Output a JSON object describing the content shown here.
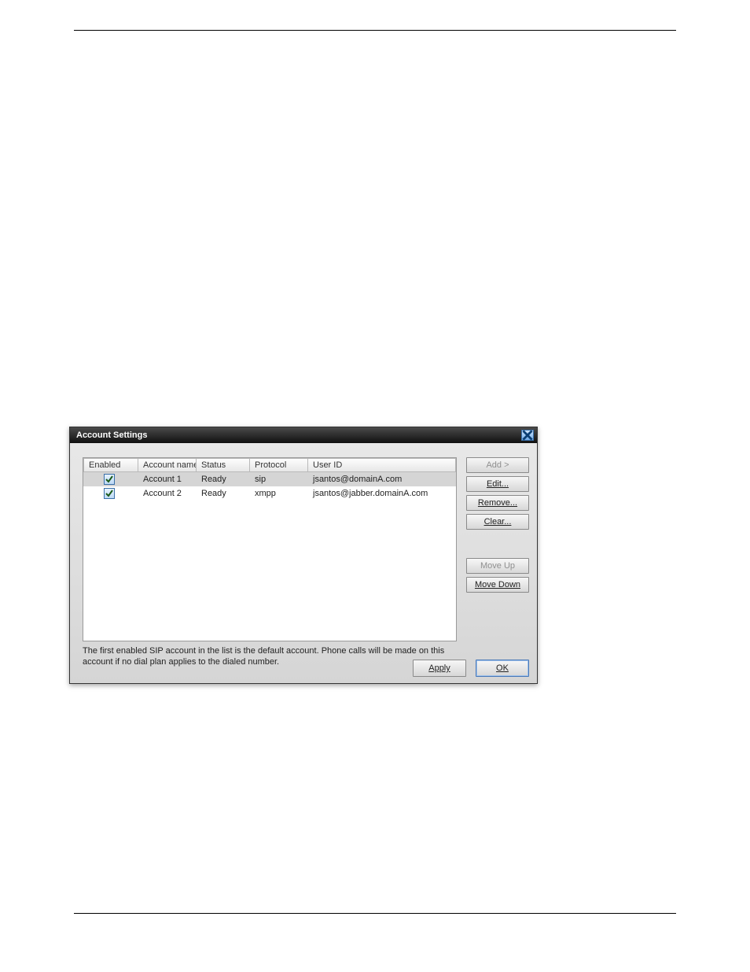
{
  "dialog": {
    "title": "Account Settings",
    "columns": {
      "enabled": "Enabled",
      "name": "Account name",
      "status": "Status",
      "protocol": "Protocol",
      "userid": "User ID"
    },
    "rows": [
      {
        "enabled": true,
        "name": "Account 1",
        "status": "Ready",
        "protocol": "sip",
        "userid": "jsantos@domainA.com",
        "selected": true
      },
      {
        "enabled": true,
        "name": "Account 2",
        "status": "Ready",
        "protocol": "xmpp",
        "userid": "jsantos@jabber.domainA.com",
        "selected": false
      }
    ],
    "hint": "The first enabled SIP account in the list is the default account. Phone calls will be made on this account if no dial plan applies to the dialed number.",
    "buttons": {
      "add": "Add >",
      "edit": "Edit...",
      "remove": "Remove...",
      "clear": "Clear...",
      "moveup": "Move Up",
      "movedown": "Move Down",
      "apply": "Apply",
      "ok": "OK"
    }
  }
}
